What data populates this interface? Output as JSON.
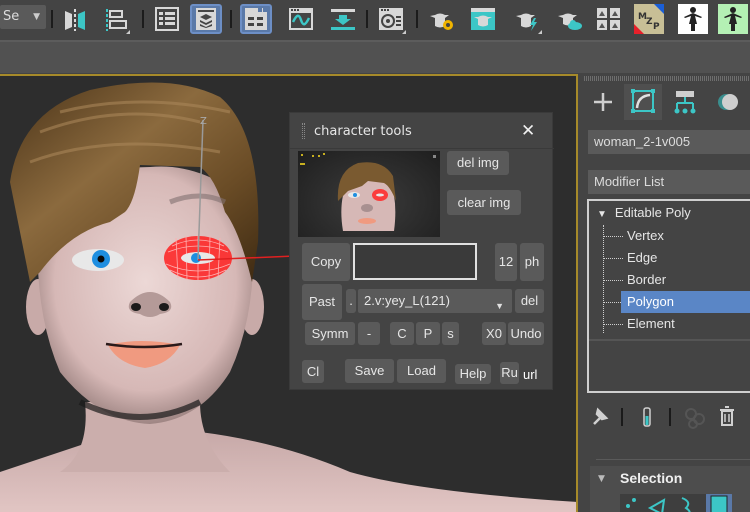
{
  "toolbar": {
    "selection_filter": "Se",
    "buttons": [
      {
        "name": "mirror",
        "icon": "mirror-icon",
        "active": false
      },
      {
        "name": "align",
        "icon": "align-icon",
        "active": false
      },
      {
        "name": "scene-explorer",
        "icon": "list-icon",
        "active": false
      },
      {
        "name": "layer-explorer",
        "icon": "layers-icon",
        "active": true
      },
      {
        "name": "ribbon-toggle",
        "icon": "ribbon-icon",
        "active": true
      },
      {
        "name": "curve-editor",
        "icon": "curve-editor-icon",
        "active": false
      },
      {
        "name": "dope-sheet",
        "icon": "dope-sheet-icon",
        "active": false
      },
      {
        "name": "material-editor",
        "icon": "material-editor-icon",
        "active": false
      },
      {
        "name": "render-setup",
        "icon": "render-setup-icon",
        "active": false
      },
      {
        "name": "rendered-frame-window",
        "icon": "rendered-frame-icon",
        "active": false
      },
      {
        "name": "render-production",
        "icon": "render-production-icon",
        "active": false
      },
      {
        "name": "render-cloud",
        "icon": "render-cloud-icon",
        "active": false
      },
      {
        "name": "viewport-layouts",
        "icon": "quad-images-icon",
        "active": false
      },
      {
        "name": "mzp-script",
        "icon": "mzp-icon",
        "label": "MZP"
      },
      {
        "name": "character-figure",
        "icon": "figure-icon"
      },
      {
        "name": "character-figure-green",
        "icon": "figure-green-icon"
      }
    ]
  },
  "viewport": {
    "gizmo_axis_label": "Z"
  },
  "dialog": {
    "title": "character tools",
    "close_label": "✕",
    "buttons": {
      "del_img": "del img",
      "clear_img": "clear img",
      "copy": "Copy",
      "twelve": "12",
      "ph": "ph",
      "past": "Past",
      "dot": ".",
      "del": "del",
      "symm": "Symm",
      "minus": "-",
      "c": "C",
      "p": "P",
      "s": "s",
      "x0": "X0",
      "undo": "Undo",
      "cl": "Cl",
      "save": "Save",
      "load": "Load",
      "help": "Help",
      "ru": "Ru"
    },
    "copy_field_value": "",
    "dropdown_value": "2.v:yey_L(121)",
    "url_label": "url"
  },
  "command_panel": {
    "tabs": [
      {
        "name": "create",
        "icon": "plus-icon",
        "active": false
      },
      {
        "name": "modify",
        "icon": "modify-icon",
        "active": true
      },
      {
        "name": "hierarchy",
        "icon": "hierarchy-icon",
        "active": false
      },
      {
        "name": "motion",
        "icon": "motion-icon",
        "active": false
      }
    ],
    "object_name": "woman_2-1v005",
    "modifier_list_label": "Modifier List",
    "stack": {
      "root": "Editable Poly",
      "items": [
        "Vertex",
        "Edge",
        "Border",
        "Polygon",
        "Element"
      ],
      "selected": "Polygon"
    },
    "stack_tools": [
      "pin-stack-icon",
      "show-end-result-icon",
      "make-unique-icon",
      "remove-modifier-icon"
    ],
    "rollout_title": "Selection"
  },
  "colors": {
    "accent_teal": "#3cc6c6",
    "selection_blue": "#5a86c6",
    "viewport_border": "#a68a2a",
    "wireframe_red": "#ff2020"
  }
}
